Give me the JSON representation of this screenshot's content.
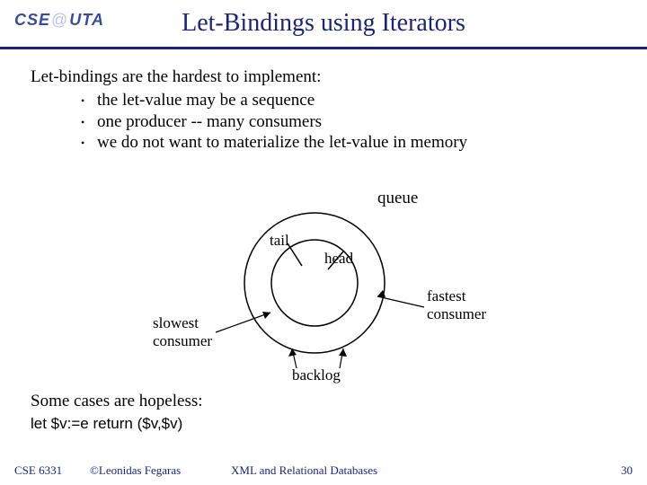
{
  "logo": {
    "left": "CSE",
    "at": "@",
    "right": "UTA"
  },
  "title": "Let-Bindings using Iterators",
  "lead": "Let-bindings are the hardest to implement:",
  "bullets": [
    "the let-value may be a sequence",
    "one producer -- many consumers",
    "we do not want to materialize the let-value in memory"
  ],
  "diagram": {
    "queue": "queue",
    "tail": "tail",
    "head": "head",
    "slowest": "slowest\nconsumer",
    "fastest": "fastest\nconsumer",
    "backlog": "backlog"
  },
  "hopeless": "Some cases are hopeless:",
  "letexpr": "let $v:=e return ($v,$v)",
  "footer": {
    "course": "CSE 6331",
    "copyright": "©Leonidas Fegaras",
    "topic": "XML and Relational Databases",
    "page": "30"
  }
}
